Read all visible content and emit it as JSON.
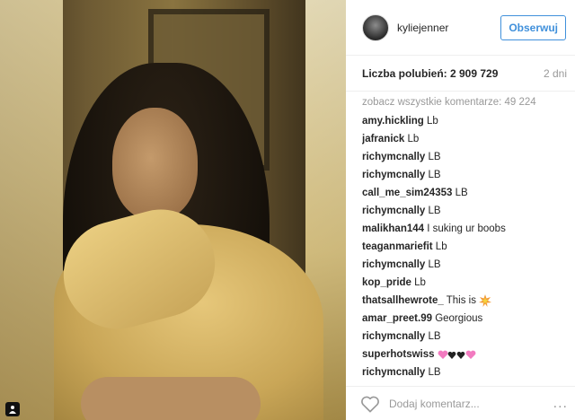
{
  "post": {
    "username": "kyliejenner",
    "follow_label": "Obserwuj",
    "likes_text": "Liczba polubień: 2 909 729",
    "age": "2 dni",
    "view_all_comments": "zobacz wszystkie komentarze: 49 224",
    "comments": [
      {
        "user": "amy.hickling",
        "text": " Lb"
      },
      {
        "user": "jafranick",
        "text": " Lb"
      },
      {
        "user": "richymcnally",
        "text": " LB"
      },
      {
        "user": "richymcnally",
        "text": " LB"
      },
      {
        "user": "call_me_sim24353",
        "text": " LB"
      },
      {
        "user": "richymcnally",
        "text": " LB"
      },
      {
        "user": "malikhan144",
        "text": " I suking ur boobs"
      },
      {
        "user": "teaganmariefit",
        "text": " Lb"
      },
      {
        "user": "richymcnally",
        "text": " LB"
      },
      {
        "user": "kop_pride",
        "text": " Lb"
      },
      {
        "user": "thatsallhewrote_",
        "text": " This is "
      },
      {
        "user": "amar_preet.99",
        "text": " Georgious"
      },
      {
        "user": "richymcnally",
        "text": " LB"
      },
      {
        "user": "superhotswiss",
        "text": " "
      },
      {
        "user": "richymcnally",
        "text": " LB"
      }
    ],
    "add_comment_placeholder": "Dodaj komentarz...",
    "more_label": "..."
  },
  "icons": {
    "like": "heart-outline-icon",
    "tagged": "person-tag-icon",
    "boom_emoji": "collision-emoji",
    "hearts_emoji": "hearts-emoji"
  }
}
